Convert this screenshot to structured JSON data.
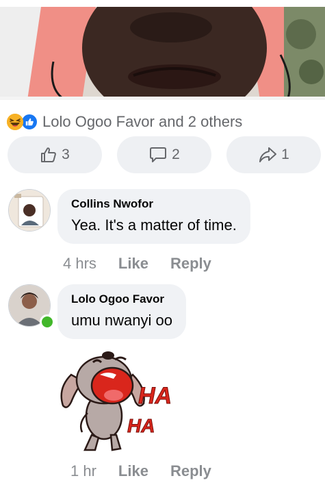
{
  "reactions": {
    "icons": [
      "haha-icon",
      "like-icon"
    ],
    "summary": "Lolo Ogoo Favor and 2 others"
  },
  "actions": {
    "like_count": "3",
    "comment_count": "2",
    "share_count": "1"
  },
  "comments": [
    {
      "author": "Collins Nwofor",
      "text": "Yea. It's a matter of time.",
      "time": "4 hrs",
      "like_label": "Like",
      "reply_label": "Reply"
    },
    {
      "author": "Lolo Ogoo Favor",
      "text": "umu nwanyi oo",
      "online": true,
      "sticker_text_1": "HA",
      "sticker_text_2": "HA",
      "time": "1 hr",
      "like_label": "Like",
      "reply_label": "Reply"
    }
  ],
  "colors": {
    "like_blue": "#1877f2",
    "online_green": "#42b72a",
    "meta_grey": "#8a8d91",
    "sticker_red": "#d9261c"
  }
}
